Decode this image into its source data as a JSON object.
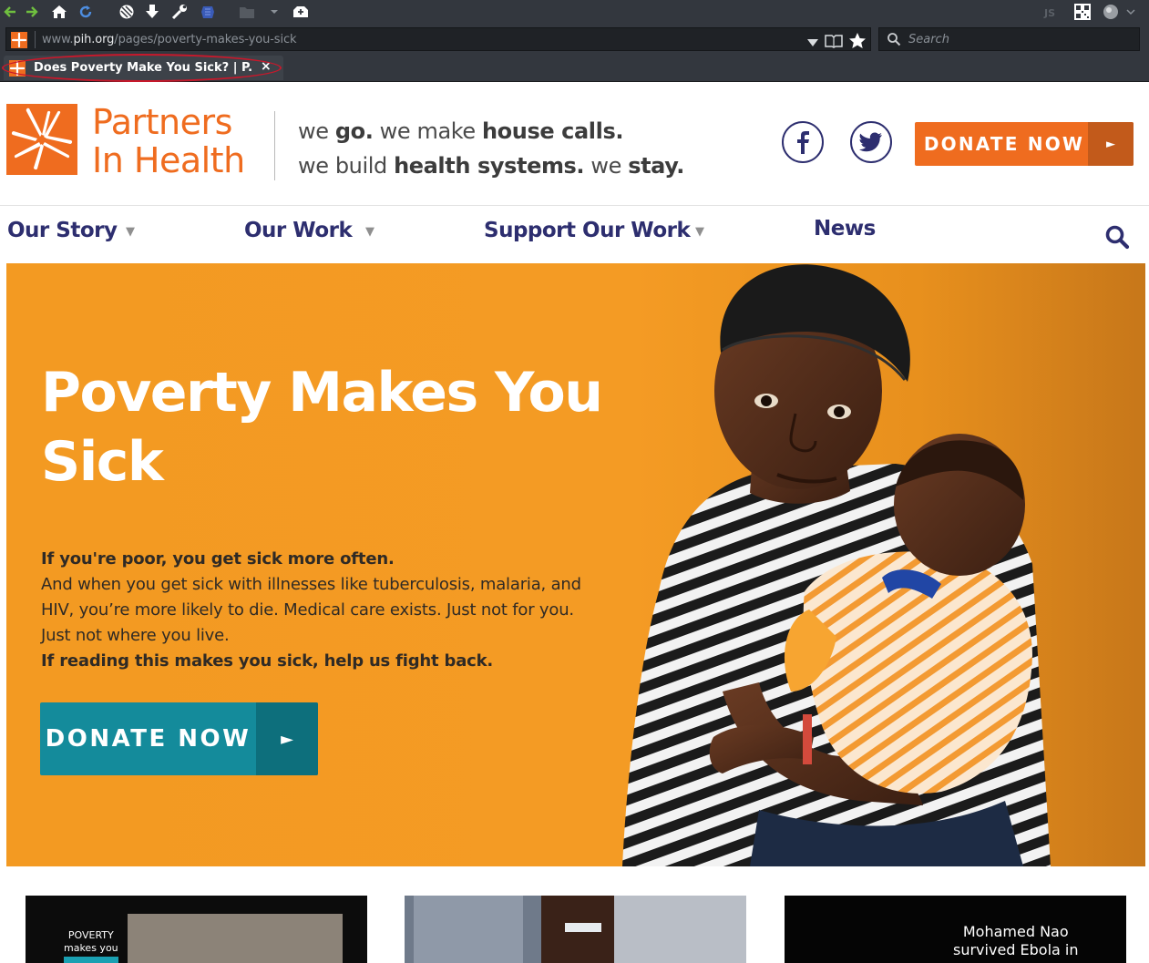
{
  "browser": {
    "url_prefix": "www.",
    "url_host": "pih.org",
    "url_path": "/pages/poverty-makes-you-sick",
    "search_placeholder": "Search",
    "tab_title": "Does Poverty Make You Sick? | P...",
    "tab_close": "×"
  },
  "header": {
    "logo_line1": "Partners",
    "logo_line2": "In Health",
    "tagline_line1": {
      "a": "we ",
      "b": "go.",
      "c": " we make ",
      "d": "house calls."
    },
    "tagline_line2": {
      "a": "we build ",
      "b": "health systems.",
      "c": " we ",
      "d": "stay."
    },
    "donate_label": "DONATE NOW",
    "donate_arrow": "►"
  },
  "nav": {
    "items": [
      {
        "label": "Our Story",
        "caret": "▼"
      },
      {
        "label": "Our Work",
        "caret": "▼"
      },
      {
        "label": "Support Our Work",
        "caret": "▼"
      },
      {
        "label": "News"
      }
    ]
  },
  "hero": {
    "title": "Poverty Makes You Sick",
    "lead": "If you're poor, you get sick more often.",
    "body": "And when you get sick with illnesses like tuberculosis, malaria, and HIV, you’re more likely to die. Medical care exists. Just not for you. Just not where you live.",
    "closing": "If reading this makes you sick, help us fight back.",
    "donate_label": "DONATE NOW",
    "donate_arrow": "►"
  },
  "thumbnails": {
    "first_caption_line1": "POVERTY",
    "first_caption_line2": "makes you",
    "third_caption_line1": "Mohamed Nao",
    "third_caption_line2": "survived Ebola in"
  },
  "colors": {
    "brand_orange": "#ef6c1f",
    "navy": "#2d2e6f",
    "teal": "#148b9b",
    "hero_orange": "#f39a22"
  }
}
